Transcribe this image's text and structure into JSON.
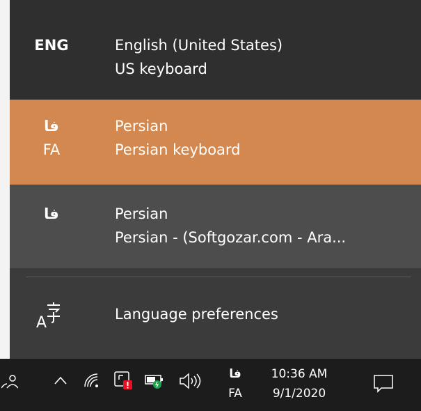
{
  "languages": [
    {
      "code_line1": "ENG",
      "code_line2": "",
      "language": "English (United States)",
      "keyboard": "US keyboard",
      "state": "normal"
    },
    {
      "code_line1": "فا",
      "code_line2": "FA",
      "language": "Persian",
      "keyboard": "Persian keyboard",
      "state": "selected"
    },
    {
      "code_line1": "فا",
      "code_line2": "",
      "language": "Persian",
      "keyboard": "Persian - (Softgozar.com - Ara...",
      "state": "hover"
    }
  ],
  "preferences": {
    "label": "Language preferences",
    "icon": "language-preferences-icon"
  },
  "taskbar": {
    "input_indicator": {
      "line1": "فا",
      "line2": "FA"
    },
    "clock": {
      "time": "10:36 AM",
      "date": "9/1/2020"
    },
    "icons": [
      "people-icon",
      "chevron-up-icon",
      "wifi-icon",
      "security-alert-icon",
      "battery-icon",
      "volume-icon",
      "notification-icon"
    ]
  },
  "colors": {
    "flyout_bg": "#3b3b3b",
    "selected_bg": "#d38850",
    "hover_bg": "#4d4d4d",
    "taskbar_bg": "#1c1c1c",
    "alert_red": "#e81123",
    "status_green": "#16a34a"
  }
}
